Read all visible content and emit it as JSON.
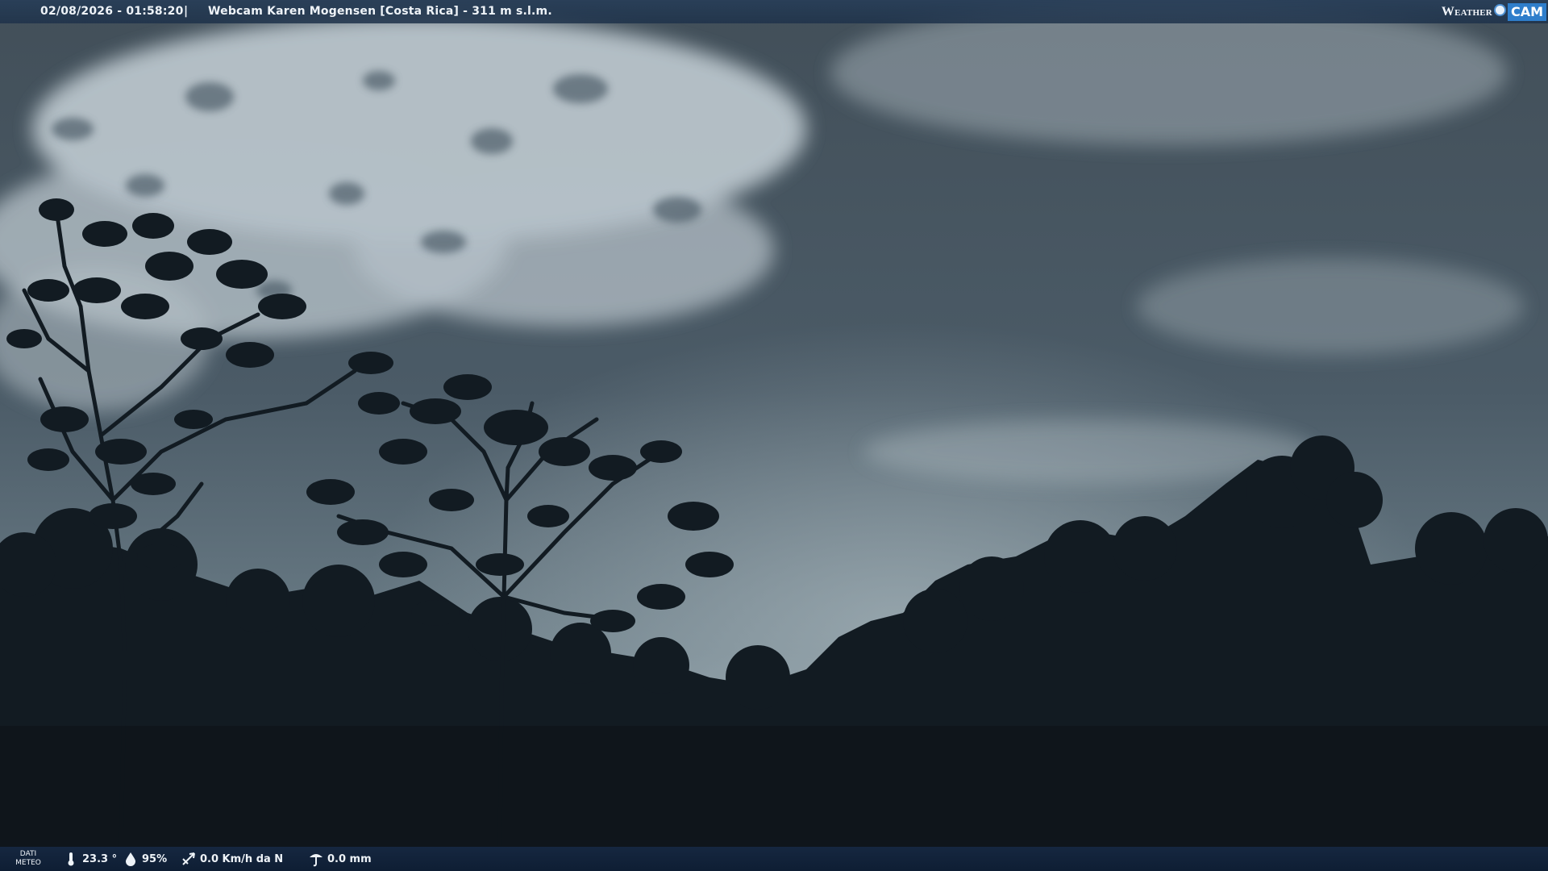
{
  "overlay": {
    "datetime": "02/08/2026 - 01:58:20",
    "separator": "|",
    "webcam_title": "Webcam Karen Mogensen [Costa Rica]  - 311 m s.l.m.",
    "brand": {
      "word": "Weather",
      "cam": "CAM"
    }
  },
  "weather": {
    "label": "DATI METEO",
    "temperature": "23.3 °",
    "humidity": "95%",
    "wind": "0.0 Km/h da N",
    "rain": "0.0 mm"
  },
  "icons": {
    "temperature": "thermometer-icon",
    "humidity": "humidity-drop-icon",
    "wind": "wind-direction-icon",
    "rain": "rain-gauge-icon"
  },
  "colors": {
    "sky_top": "#43535f",
    "sky_bottom": "#7f9199",
    "clouds": "#cdd8de",
    "foliage": "#0f161c",
    "bar": "#1d3a5c",
    "brand_blue": "#2f7ecb"
  }
}
